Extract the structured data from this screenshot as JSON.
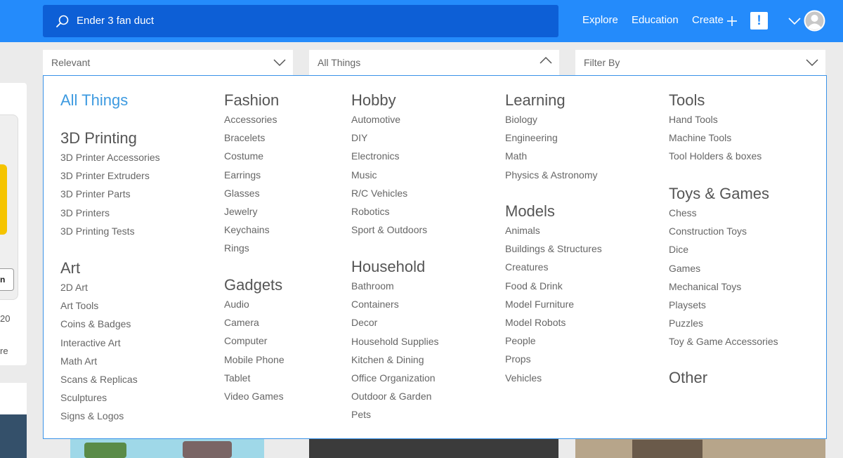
{
  "header": {
    "search_value": "Ender 3 fan duct",
    "nav": {
      "explore": "Explore",
      "education": "Education",
      "create": "Create"
    },
    "alert_label": "!",
    "icons": {
      "search": "search-icon",
      "create": "plus-icon",
      "menu": "chevron-down-icon",
      "avatar": "user-avatar-icon"
    },
    "colors": {
      "bar": "#248bfb",
      "search_bg": "#0d5fd6"
    }
  },
  "filters": {
    "sort": "Relevant",
    "category": "All Things",
    "filter_by": "Filter By"
  },
  "background": {
    "card_count": "20",
    "card_more": "re",
    "card_button": "n"
  },
  "dropdown": {
    "all_things": "All Things",
    "groups": [
      {
        "title": "3D Printing",
        "items": [
          "3D Printer Accessories",
          "3D Printer Extruders",
          "3D Printer Parts",
          "3D Printers",
          "3D Printing Tests"
        ]
      },
      {
        "title": "Art",
        "items": [
          "2D Art",
          "Art Tools",
          "Coins & Badges",
          "Interactive Art",
          "Math Art",
          "Scans & Replicas",
          "Sculptures",
          "Signs & Logos"
        ]
      },
      {
        "title": "Fashion",
        "items": [
          "Accessories",
          "Bracelets",
          "Costume",
          "Earrings",
          "Glasses",
          "Jewelry",
          "Keychains",
          "Rings"
        ]
      },
      {
        "title": "Gadgets",
        "items": [
          "Audio",
          "Camera",
          "Computer",
          "Mobile Phone",
          "Tablet",
          "Video Games"
        ]
      },
      {
        "title": "Hobby",
        "items": [
          "Automotive",
          "DIY",
          "Electronics",
          "Music",
          "R/C Vehicles",
          "Robotics",
          "Sport & Outdoors"
        ]
      },
      {
        "title": "Household",
        "items": [
          "Bathroom",
          "Containers",
          "Decor",
          "Household Supplies",
          "Kitchen & Dining",
          "Office Organization",
          "Outdoor & Garden",
          "Pets"
        ]
      },
      {
        "title": "Learning",
        "items": [
          "Biology",
          "Engineering",
          "Math",
          "Physics & Astronomy"
        ]
      },
      {
        "title": "Models",
        "items": [
          "Animals",
          "Buildings & Structures",
          "Creatures",
          "Food & Drink",
          "Model Furniture",
          "Model Robots",
          "People",
          "Props",
          "Vehicles"
        ]
      },
      {
        "title": "Tools",
        "items": [
          "Hand Tools",
          "Machine Tools",
          "Tool Holders & boxes"
        ]
      },
      {
        "title": "Toys & Games",
        "items": [
          "Chess",
          "Construction Toys",
          "Dice",
          "Games",
          "Mechanical Toys",
          "Playsets",
          "Puzzles",
          "Toy & Game Accessories"
        ]
      },
      {
        "title": "Other",
        "items": []
      }
    ]
  }
}
